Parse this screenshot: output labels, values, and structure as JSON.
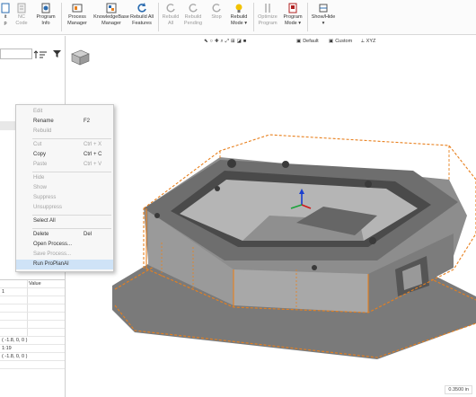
{
  "ribbon": {
    "buttons": [
      {
        "label": "it",
        "label2": "p"
      },
      {
        "label": "NC",
        "label2": "Code"
      },
      {
        "label": "Program",
        "label2": "Info"
      },
      {
        "label": "Process",
        "label2": "Manager"
      },
      {
        "label": "KnowledgeBase",
        "label2": "Manager"
      },
      {
        "label": "Rebuild All",
        "label2": "Features"
      },
      {
        "label": "Rebuild",
        "label2": "All"
      },
      {
        "label": "Rebuild",
        "label2": "Pending"
      },
      {
        "label": "Stop",
        "label2": ""
      },
      {
        "label": "Rebuild",
        "label2": "Mode"
      },
      {
        "label": "Optimize",
        "label2": "Program"
      },
      {
        "label": "Program",
        "label2": "Mode"
      },
      {
        "label": "Show/Hide",
        "label2": ""
      }
    ]
  },
  "viewport_toolbar": {
    "default_label": "Default",
    "custom_label": "Custom",
    "xyz_label": "XYZ"
  },
  "properties": {
    "header": "Value",
    "rows": [
      {
        "c1": "",
        "c2": "1"
      },
      {
        "c1": "",
        "c2": ""
      },
      {
        "c1": "",
        "c2": ""
      },
      {
        "c1": "",
        "c2": ""
      },
      {
        "c1": "",
        "c2": ""
      },
      {
        "c1": "",
        "c2": ""
      },
      {
        "c1": "( -1.8, 0, 0 )",
        "c2": ""
      },
      {
        "c1": "1:19",
        "c2": ""
      },
      {
        "c1": "( -1.8, 0, 0 )",
        "c2": ""
      },
      {
        "c1": "",
        "c2": ""
      }
    ]
  },
  "context_menu": {
    "items": [
      {
        "label": "Edit",
        "shortcut": "",
        "disabled": true
      },
      {
        "label": "Rename",
        "shortcut": "F2",
        "disabled": false
      },
      {
        "label": "Rebuild",
        "shortcut": "",
        "disabled": true
      },
      {
        "sep": true
      },
      {
        "label": "Cut",
        "shortcut": "Ctrl + X",
        "disabled": true
      },
      {
        "label": "Copy",
        "shortcut": "Ctrl + C",
        "disabled": false
      },
      {
        "label": "Paste",
        "shortcut": "Ctrl + V",
        "disabled": true
      },
      {
        "sep": true
      },
      {
        "label": "Hide",
        "shortcut": "",
        "disabled": true
      },
      {
        "label": "Show",
        "shortcut": "",
        "disabled": true
      },
      {
        "label": "Suppress",
        "shortcut": "",
        "disabled": true
      },
      {
        "label": "Unsuppress",
        "shortcut": "",
        "disabled": true
      },
      {
        "sep": true
      },
      {
        "label": "Select All",
        "shortcut": "",
        "disabled": false
      },
      {
        "sep": true
      },
      {
        "label": "Delete",
        "shortcut": "Del",
        "disabled": false
      },
      {
        "label": "Open Process...",
        "shortcut": "",
        "disabled": false
      },
      {
        "label": "Save Process...",
        "shortcut": "",
        "disabled": true
      },
      {
        "label": "Run ProPlanAI",
        "shortcut": "",
        "disabled": false,
        "highlighted": true
      }
    ]
  },
  "status": {
    "measure": "0.3500 in"
  },
  "colors": {
    "accent": "#e8801e",
    "part": "#8d8d8d",
    "highlight": "#cfe3f7"
  }
}
